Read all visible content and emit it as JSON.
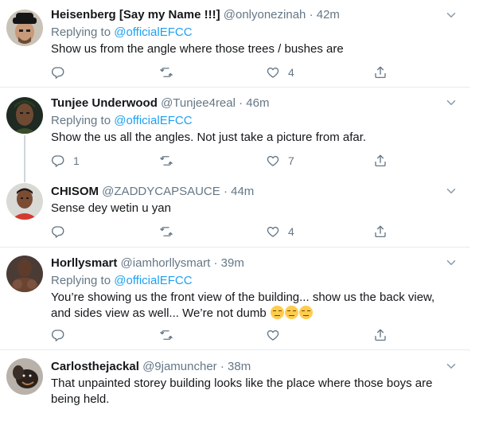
{
  "tweets": [
    {
      "name": "Heisenberg [Say my Name !!!]",
      "handle": "@onlyonezinah",
      "time": "42m",
      "replying_prefix": "Replying to",
      "replying_to": "@officialEFCC",
      "lines": [
        "Show us from the angle where those trees / bushes are"
      ],
      "reply_count": "",
      "retweet_count": "",
      "like_count": "4"
    },
    {
      "name": "Tunjee Underwood",
      "handle": "@Tunjee4real",
      "time": "46m",
      "replying_prefix": "Replying to",
      "replying_to": "@officialEFCC",
      "lines": [
        "Show the us all the angles. Not just take a picture from afar."
      ],
      "reply_count": "1",
      "retweet_count": "",
      "like_count": "7"
    },
    {
      "name": "CHISOM",
      "handle": "@ZADDYCAPSAUCE",
      "time": "44m",
      "lines": [
        "Sense dey wetin u yan"
      ],
      "reply_count": "",
      "retweet_count": "",
      "like_count": "4"
    },
    {
      "name": "Horllysmart",
      "handle": "@iamhorllysmart",
      "time": "39m",
      "replying_prefix": "Replying to",
      "replying_to": "@officialEFCC",
      "lines": [
        "You’re showing us the front view of the building... show us the back view,",
        "and sides view as well... We’re not dumb"
      ],
      "emoji_name": "unamused-face-emoji",
      "reply_count": "",
      "retweet_count": "",
      "like_count": ""
    },
    {
      "name": "Carlosthejackal",
      "handle": "@9jamuncher",
      "time": "38m",
      "lines": [
        "That unpainted storey building looks like the place where those boys are",
        "being held."
      ]
    }
  ],
  "separator": "·",
  "icons": {
    "reply": "reply-icon",
    "retweet": "retweet-icon",
    "like": "heart-icon",
    "share": "share-icon",
    "more": "chevron-down-icon"
  },
  "colors": {
    "link": "#1da1f2",
    "muted": "#657786",
    "text": "#14171a",
    "border": "#e6ecf0",
    "thread_line": "#ccd6dd"
  }
}
